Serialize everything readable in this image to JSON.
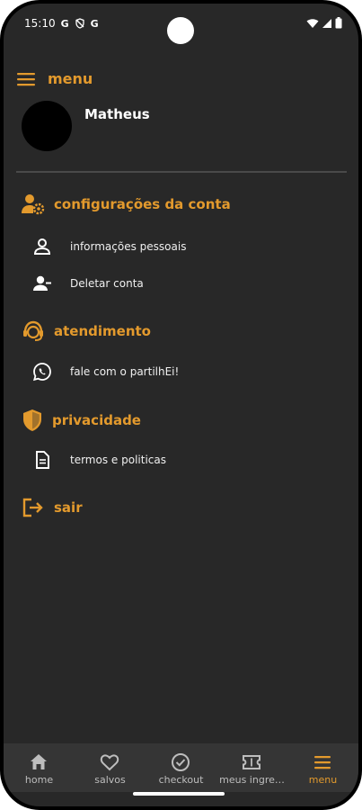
{
  "status_bar": {
    "time": "15:10",
    "left_icons": [
      "G",
      "G"
    ]
  },
  "header": {
    "title": "menu"
  },
  "profile": {
    "name": "Matheus"
  },
  "sections": [
    {
      "title": "configurações da conta",
      "icon": "account-settings-icon",
      "items": [
        {
          "label": "informações pessoais",
          "icon": "person-icon"
        },
        {
          "label": "Deletar conta",
          "icon": "person-remove-icon"
        }
      ]
    },
    {
      "title": "atendimento",
      "icon": "support-agent-icon",
      "items": [
        {
          "label": "fale com o partilhEi!",
          "icon": "whatsapp-icon"
        }
      ]
    },
    {
      "title": "privacidade",
      "icon": "shield-icon",
      "items": [
        {
          "label": "termos e politicas",
          "icon": "document-icon"
        }
      ]
    },
    {
      "title": "sair",
      "icon": "logout-icon",
      "items": []
    }
  ],
  "bottom_nav": [
    {
      "label": "home",
      "icon": "home-icon",
      "active": false
    },
    {
      "label": "salvos",
      "icon": "heart-icon",
      "active": false
    },
    {
      "label": "checkout",
      "icon": "check-circle-icon",
      "active": false
    },
    {
      "label": "meus ingre…",
      "icon": "ticket-icon",
      "active": false
    },
    {
      "label": "menu",
      "icon": "menu-icon",
      "active": true
    }
  ],
  "colors": {
    "accent": "#E39A2D",
    "background": "#282828",
    "nav_background": "#353535"
  }
}
